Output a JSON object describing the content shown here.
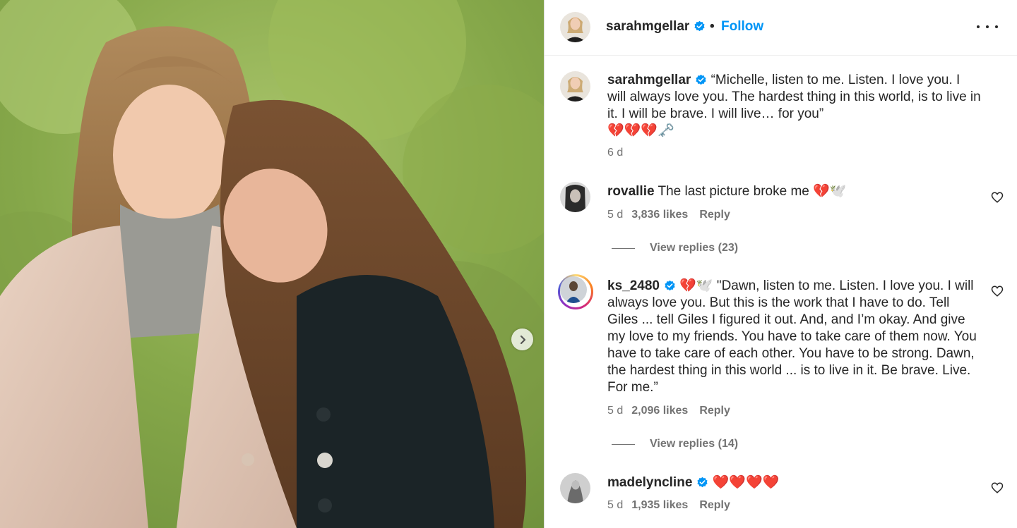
{
  "post": {
    "media_description_icon": "photo",
    "carousel_next_icon": "chevron-right-icon"
  },
  "header": {
    "username": "sarahmgellar",
    "separator": "•",
    "follow_label": "Follow",
    "more_icon": "more-horizontal-icon"
  },
  "caption": {
    "username": "sarahmgellar",
    "text": "“Michelle, listen to me. Listen. I love you. I will always love you. The hardest thing in this world, is to live in it. I will be brave. I will live… for you”",
    "emoji": "💔💔💔🗝️",
    "time": "6 d"
  },
  "comments": [
    {
      "username": "rovallie",
      "text": "The last picture broke me 💔🕊️",
      "time": "5 d",
      "likes": "3,836 likes",
      "reply_label": "Reply",
      "view_replies": "View replies (23)"
    },
    {
      "username": "ks_2480",
      "text": "💔🕊️ \"Dawn, listen to me. Listen. I love you. I will always love you. But this is the work that I have to do. Tell Giles ... tell Giles I figured it out. And, and I’m okay. And give my love to my friends. You have to take care of them now. You have to take care of each other. You have to be strong. Dawn, the hardest thing in this world ... is to live in it. Be brave. Live. For me.”",
      "time": "5 d",
      "likes": "2,096 likes",
      "reply_label": "Reply",
      "view_replies": "View replies (14)"
    },
    {
      "username": "madelyncline",
      "text": "❤️❤️❤️❤️",
      "time": "5 d",
      "likes": "1,935 likes",
      "reply_label": "Reply"
    }
  ],
  "colors": {
    "follow": "#0095f6",
    "verified": "#0095f6",
    "text": "#262626",
    "secondary": "#737373"
  }
}
